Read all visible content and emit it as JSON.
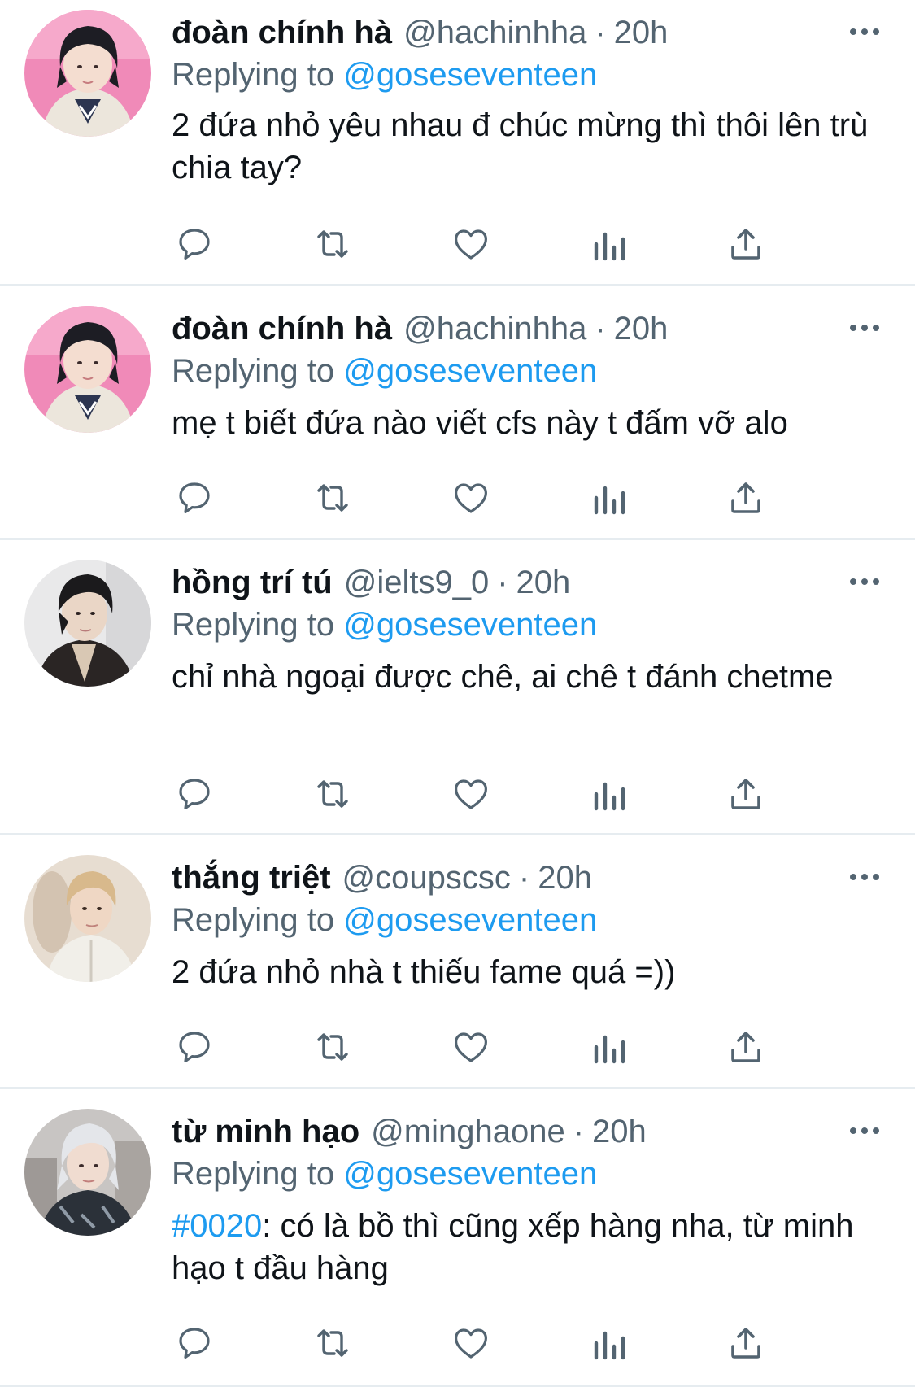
{
  "tweets": [
    {
      "name": "đoàn chính hà",
      "handle": "@hachinhha",
      "sep": "·",
      "time": "20h",
      "replying_label": "Replying to",
      "reply_to": "@goseseventeen",
      "hashtag": "",
      "text": "2 đứa nhỏ yêu nhau đ chúc mừng thì thôi lên trù chia tay?",
      "avatar": "girl-avatar-pink"
    },
    {
      "name": "đoàn chính hà",
      "handle": "@hachinhha",
      "sep": "·",
      "time": "20h",
      "replying_label": "Replying to",
      "reply_to": "@goseseventeen",
      "hashtag": "",
      "text": "mẹ t biết đứa nào viết cfs này t đấm vỡ alo",
      "avatar": "girl-avatar-pink"
    },
    {
      "name": "hồng trí tú",
      "handle": "@ielts9_0",
      "sep": "·",
      "time": "20h",
      "replying_label": "Replying to",
      "reply_to": "@goseseventeen",
      "hashtag": "",
      "text": "chỉ nhà ngoại được chê, ai chê t đánh chetme",
      "avatar": "man-avatar-dark"
    },
    {
      "name": "thắng triệt",
      "handle": "@coupscsc",
      "sep": "·",
      "time": "20h",
      "replying_label": "Replying to",
      "reply_to": "@goseseventeen",
      "hashtag": "",
      "text": "2 đứa nhỏ nhà t thiếu fame quá =))",
      "avatar": "man-avatar-blond"
    },
    {
      "name": "từ minh hạo",
      "handle": "@minghaone",
      "sep": "·",
      "time": "20h",
      "replying_label": "Replying to",
      "reply_to": "@goseseventeen",
      "hashtag": "#0020",
      "text": ": có là bồ thì cũng xếp hàng nha, từ minh hạo t đầu hàng",
      "avatar": "man-avatar-silver"
    }
  ],
  "icons": {
    "reply": "reply-icon",
    "retweet": "retweet-icon",
    "like": "heart-icon",
    "analytics": "analytics-icon",
    "share": "share-icon",
    "more": "more-icon"
  },
  "colors": {
    "accent": "#1d9bf0",
    "secondary_text": "#536471",
    "divider": "#e6ecf0"
  }
}
